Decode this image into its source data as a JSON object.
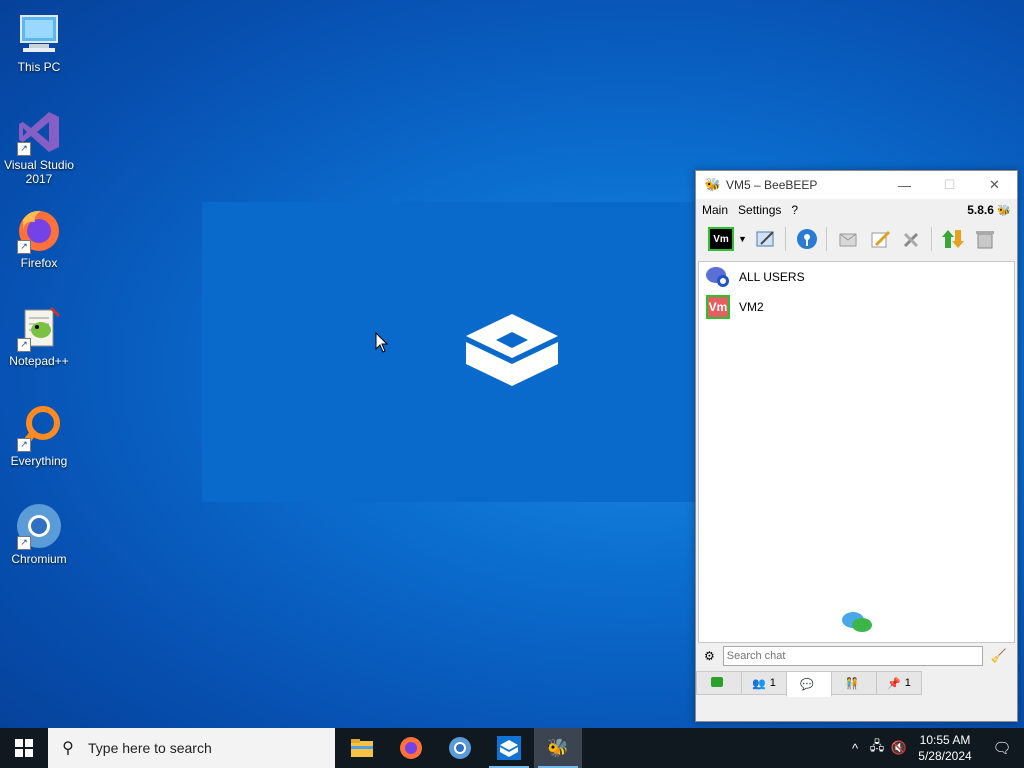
{
  "desktop": {
    "icons": [
      {
        "label": "This PC"
      },
      {
        "label": "Visual Studio 2017"
      },
      {
        "label": "Firefox"
      },
      {
        "label": "Notepad++"
      },
      {
        "label": "Everything"
      },
      {
        "label": "Chromium"
      }
    ]
  },
  "window": {
    "title": "VM5 – BeeBEEP",
    "menu": [
      "Main",
      "Settings",
      "?"
    ],
    "version": "5.8.6",
    "toolbar_user_badge": "Vm",
    "chats": [
      {
        "label": "ALL USERS"
      },
      {
        "label": "VM2",
        "badge": "Vm"
      }
    ],
    "search_placeholder": "Search chat",
    "tabs": [
      {
        "count": ""
      },
      {
        "count": "1"
      },
      {
        "count": ""
      },
      {
        "count": ""
      },
      {
        "count": "1"
      }
    ]
  },
  "taskbar": {
    "search_placeholder": "Type here to search",
    "time": "10:55 AM",
    "date": "5/28/2024"
  }
}
